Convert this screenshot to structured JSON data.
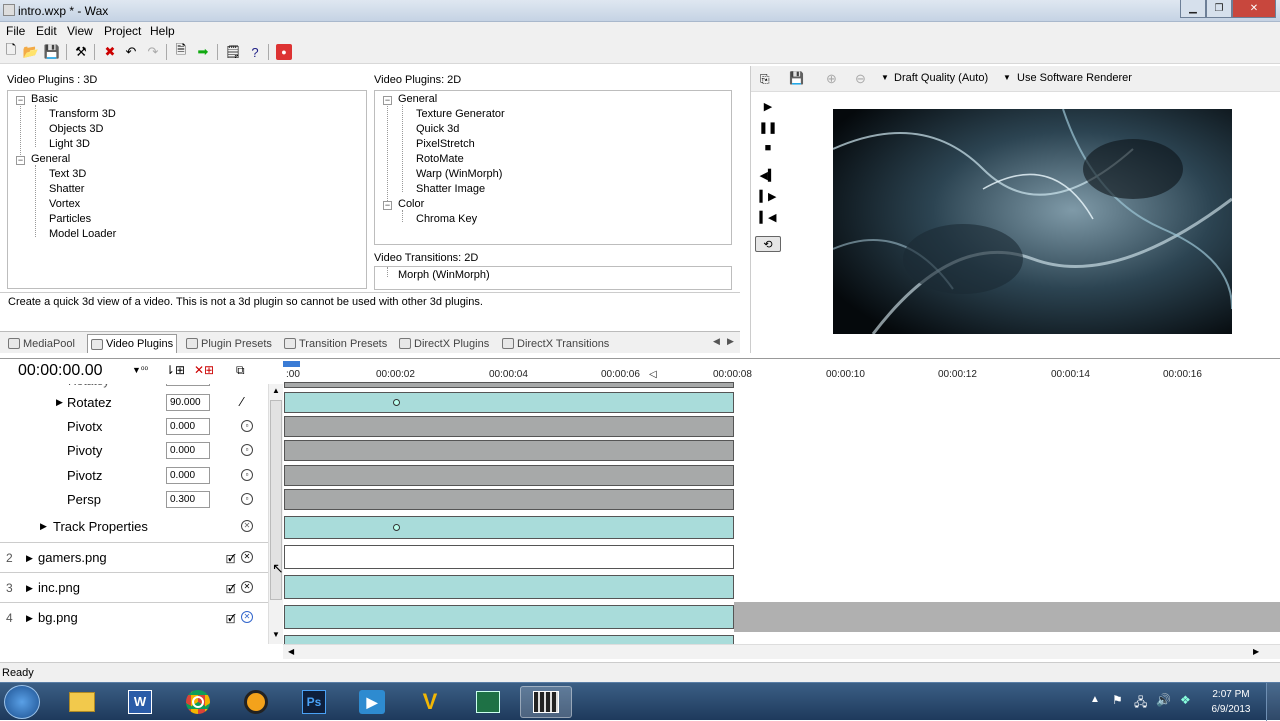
{
  "window": {
    "title": "intro.wxp * - Wax"
  },
  "menu": [
    "File",
    "Edit",
    "View",
    "Project",
    "Help"
  ],
  "plugins3d": {
    "label": "Video Plugins : 3D",
    "groups": [
      {
        "name": "Basic",
        "items": [
          "Transform 3D",
          "Objects 3D",
          "Light 3D"
        ]
      },
      {
        "name": "General",
        "items": [
          "Text 3D",
          "Shatter",
          "Vortex",
          "Particles",
          "Model Loader"
        ]
      }
    ]
  },
  "plugins2d": {
    "label": "Video Plugins: 2D",
    "groups": [
      {
        "name": "General",
        "items": [
          "Texture Generator",
          "Quick 3d",
          "PixelStretch",
          "RotoMate",
          "Warp (WinMorph)",
          "Shatter Image"
        ]
      },
      {
        "name": "Color",
        "items": [
          "Chroma Key"
        ]
      }
    ]
  },
  "transitions2d": {
    "label": "Video Transitions: 2D",
    "items": [
      "Morph (WinMorph)"
    ]
  },
  "description": "Create a quick 3d view of a video. This is not a 3d plugin so cannot be used with other 3d plugins.",
  "tabs": [
    "MediaPool",
    "Video Plugins",
    "Plugin Presets",
    "Transition Presets",
    "DirectX Plugins",
    "DirectX Transitions"
  ],
  "preview": {
    "quality": "Draft Quality (Auto)",
    "renderer": "Use Software Renderer"
  },
  "timeline": {
    "timecode": "00:00:00.00",
    "ticks": [
      ":00",
      "00:00:02",
      "00:00:04",
      "00:00:06",
      "00:00:08",
      "00:00:10",
      "00:00:12",
      "00:00:14",
      "00:00:16"
    ],
    "properties": [
      {
        "name": "Rotatez",
        "value": "90.000"
      },
      {
        "name": "Pivotx",
        "value": "0.000"
      },
      {
        "name": "Pivoty",
        "value": "0.000"
      },
      {
        "name": "Pivotz",
        "value": "0.000"
      },
      {
        "name": "Persp",
        "value": "0.300"
      }
    ],
    "track_properties": "Track Properties",
    "tracks": [
      {
        "num": "2",
        "name": "gamers.png"
      },
      {
        "num": "3",
        "name": "inc.png"
      },
      {
        "num": "4",
        "name": "bg.png"
      }
    ]
  },
  "status": "Ready",
  "clock": {
    "time": "2:07 PM",
    "date": "6/9/2013"
  },
  "taskbar_apps": [
    "start-orb-icon",
    "explorer-icon",
    "word-icon",
    "chrome-icon",
    "winamp-icon",
    "photoshop-icon",
    "media-player-icon",
    "vegas-icon",
    "excel-icon",
    "wax-icon"
  ]
}
